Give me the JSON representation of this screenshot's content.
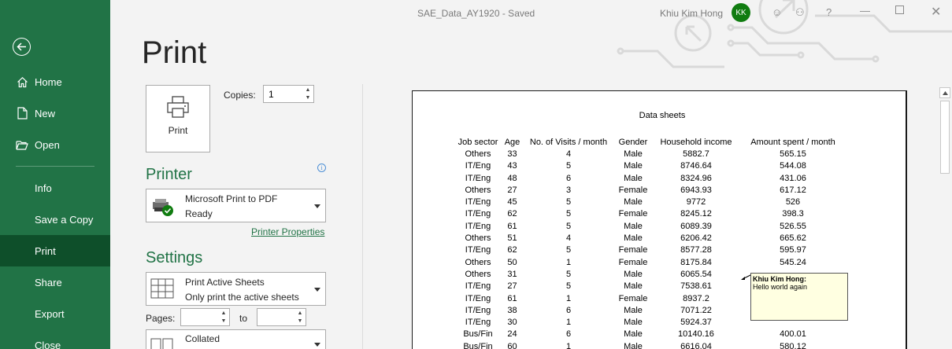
{
  "window": {
    "document_title": "SAE_Data_AY1920  -  Saved",
    "user_name": "Khiu Kim Hong",
    "user_initials": "KK"
  },
  "nav": {
    "items": [
      {
        "label": "Home",
        "icon": "home-icon"
      },
      {
        "label": "New",
        "icon": "new-document-icon"
      },
      {
        "label": "Open",
        "icon": "open-folder-icon"
      },
      {
        "label": "Info"
      },
      {
        "label": "Save a Copy"
      },
      {
        "label": "Print",
        "selected": true
      },
      {
        "label": "Share"
      },
      {
        "label": "Export"
      },
      {
        "label": "Close"
      }
    ]
  },
  "print": {
    "page_title": "Print",
    "print_button_label": "Print",
    "copies_label": "Copies:",
    "copies_value": "1",
    "printer_heading": "Printer",
    "printer_name": "Microsoft Print to PDF",
    "printer_status": "Ready",
    "printer_properties_link": "Printer Properties",
    "settings_heading": "Settings",
    "sheets_option": "Print Active Sheets",
    "sheets_option_desc": "Only print the active sheets",
    "pages_label": "Pages:",
    "to_label": "to",
    "pages_from": "",
    "pages_to": "",
    "collation_option": "Collated"
  },
  "preview": {
    "sheet_title": "Data sheets",
    "columns": [
      "Job sector",
      "Age",
      "No. of Visits / month",
      "Gender",
      "Household income",
      "Amount spent / month"
    ],
    "rows": [
      [
        "Others",
        "33",
        "4",
        "Male",
        "5882.7",
        "565.15"
      ],
      [
        "IT/Eng",
        "43",
        "5",
        "Male",
        "8746.64",
        "544.08"
      ],
      [
        "IT/Eng",
        "48",
        "6",
        "Male",
        "8324.96",
        "431.06"
      ],
      [
        "Others",
        "27",
        "3",
        "Female",
        "6943.93",
        "617.12"
      ],
      [
        "IT/Eng",
        "45",
        "5",
        "Male",
        "9772",
        "526"
      ],
      [
        "IT/Eng",
        "62",
        "5",
        "Female",
        "8245.12",
        "398.3"
      ],
      [
        "IT/Eng",
        "61",
        "5",
        "Male",
        "6089.39",
        "526.55"
      ],
      [
        "Others",
        "51",
        "4",
        "Male",
        "6206.42",
        "665.62"
      ],
      [
        "IT/Eng",
        "62",
        "5",
        "Female",
        "8577.28",
        "595.97"
      ],
      [
        "Others",
        "50",
        "1",
        "Female",
        "8175.84",
        "545.24"
      ],
      [
        "Others",
        "31",
        "5",
        "Male",
        "6065.54",
        ""
      ],
      [
        "IT/Eng",
        "27",
        "5",
        "Male",
        "7538.61",
        ""
      ],
      [
        "IT/Eng",
        "61",
        "1",
        "Female",
        "8937.2",
        ""
      ],
      [
        "IT/Eng",
        "38",
        "6",
        "Male",
        "7071.22",
        ""
      ],
      [
        "IT/Eng",
        "30",
        "1",
        "Male",
        "5924.37",
        ""
      ],
      [
        "Bus/Fin",
        "24",
        "6",
        "Male",
        "10140.16",
        "400.01"
      ],
      [
        "Bus/Fin",
        "60",
        "1",
        "Male",
        "6616.04",
        "580.12"
      ]
    ],
    "comment": {
      "author": "Khiu Kim Hong:",
      "text": "Hello world again"
    }
  },
  "colors": {
    "accent": "#217346",
    "nav_selected": "#0e4f2a",
    "avatar": "#107c10"
  }
}
